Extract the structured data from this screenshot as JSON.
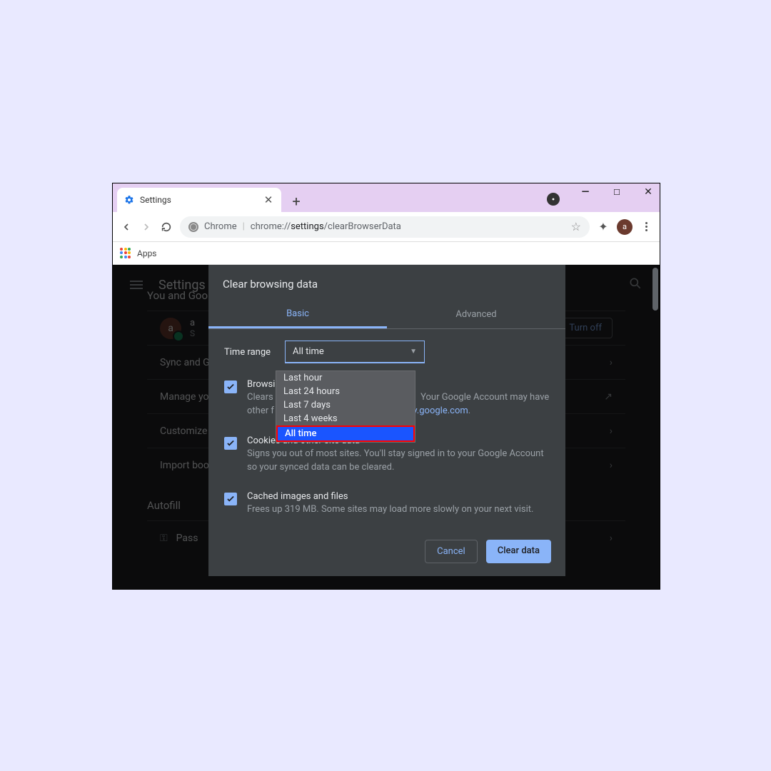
{
  "window": {
    "tab_title": "Settings",
    "min": "—",
    "max": "▢",
    "close": "✕"
  },
  "addressbar": {
    "scheme": "Chrome",
    "prefix": "chrome://",
    "bold": "settings",
    "rest": "/clearBrowserData",
    "avatar": "a"
  },
  "bookmarks": {
    "apps": "Apps"
  },
  "settings": {
    "title": "Settings",
    "section1": "You and Goo",
    "avatar": "a",
    "row_account_name": "a",
    "row_account_sub": "S",
    "turn_off": "Turn off",
    "row_sync": "Sync and G",
    "row_manage": "Manage yo",
    "row_customize": "Customize",
    "row_import": "Import boo",
    "section2": "Autofill",
    "row_passwords": "Pass"
  },
  "dialog": {
    "title": "Clear browsing data",
    "tabs": {
      "basic": "Basic",
      "advanced": "Advanced"
    },
    "time_range_label": "Time range",
    "select_value": "All time",
    "dropdown": [
      "Last hour",
      "Last 24 hours",
      "Last 7 days",
      "Last 4 weeks",
      "All time"
    ],
    "items": [
      {
        "title": "Browsi",
        "desc_a": "Clears",
        "desc_b": "Your Google Account may have",
        "desc_c": "other f",
        "desc_link": "ity.google.com",
        "desc_d": "."
      },
      {
        "title": "Cookies and other site data",
        "desc": "Signs you out of most sites. You'll stay signed in to your Google Account so your synced data can be cleared."
      },
      {
        "title": "Cached images and files",
        "desc": "Frees up 319 MB. Some sites may load more slowly on your next visit."
      }
    ],
    "cancel": "Cancel",
    "clear": "Clear data"
  }
}
